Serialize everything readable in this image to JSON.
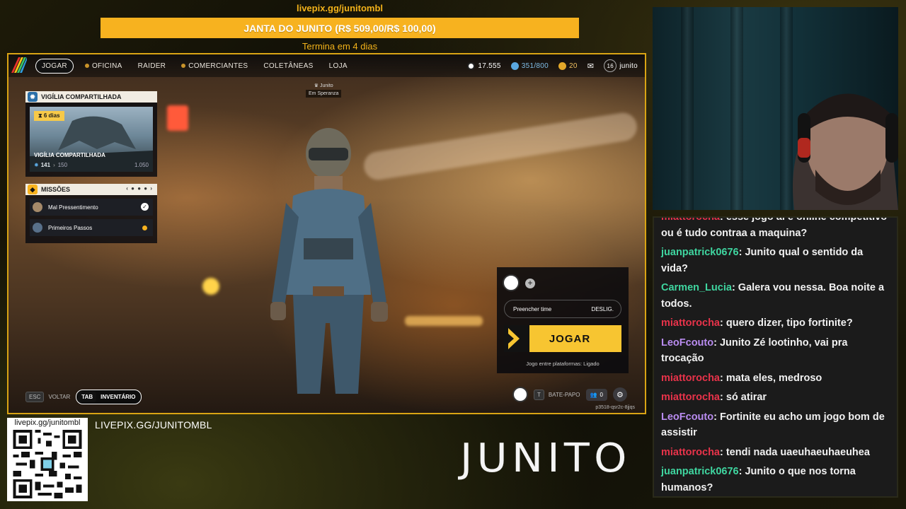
{
  "banner": {
    "livepix_url": "livepix.gg/junitombl",
    "goal_text": "JANTA DO JUNITO (R$ 509,00/R$ 100,00)",
    "goal_timer": "Termina em 4 dias",
    "goal_color": "#f7b21f"
  },
  "game": {
    "nav": {
      "items": [
        {
          "label": "JOGAR",
          "active": true
        },
        {
          "label": "OFICINA"
        },
        {
          "label": "RAIDER"
        },
        {
          "label": "COMERCIANTES"
        },
        {
          "label": "COLETÂNEAS"
        },
        {
          "label": "LOJA"
        }
      ],
      "credits": "17.555",
      "tokens": "351/800",
      "coins": "20",
      "level": "16",
      "username": "junito"
    },
    "location": {
      "name": "Junito",
      "place": "Em Speranza"
    },
    "vigil": {
      "header": "VIGÍLIA COMPARTILHADA",
      "days": "6 dias",
      "title": "VIGÍLIA COMPARTILHADA",
      "current": "141",
      "next": "150",
      "max": "1.050"
    },
    "missions": {
      "header": "MISSÕES",
      "items": [
        {
          "label": "Mal Pressentimento",
          "status": "complete"
        },
        {
          "label": "Primeiros Passos",
          "status": "active"
        }
      ]
    },
    "play": {
      "fill_team_label": "Preencher time",
      "fill_team_value": "DESLIG.",
      "play_label": "JOGAR",
      "crossplay": "Jogo entre plataformas: Ligado"
    },
    "bottom": {
      "esc_key": "ESC",
      "back_label": "VOLTAR",
      "tab_key": "TAB",
      "inventory_label": "INVENTÁRIO",
      "chat_key": "T",
      "chat_label": "BATE-PAPO",
      "friends_count": "0",
      "lobby_code": "p3518-qsr2c-8jjqs"
    }
  },
  "overlay": {
    "qr_url": "livepix.gg/junitombl",
    "livepix_caption": "LIVEPIX.GG/JUNITOMBL",
    "brand": "JUNITO"
  },
  "chat": {
    "messages": [
      {
        "user": "miattorocha",
        "color": "#e8334a",
        "text": ": esse jogo ai é online competitivo ou é tudo contraa a maquina?"
      },
      {
        "user": "juanpatrick0676",
        "color": "#3fd6a0",
        "text": ": Junito qual o sentido da vida?"
      },
      {
        "user": "Carmen_Lucia",
        "color": "#3fd6a0",
        "text": ": Galera vou nessa. Boa noite a todos."
      },
      {
        "user": "miattorocha",
        "color": "#e8334a",
        "text": ": quero dizer, tipo fortinite?"
      },
      {
        "user": "LeoFcouto",
        "color": "#b98cf0",
        "text": ": Junito Zé lootinho, vai pra trocação"
      },
      {
        "user": "miattorocha",
        "color": "#e8334a",
        "text": ": mata eles, medroso"
      },
      {
        "user": "miattorocha",
        "color": "#e8334a",
        "text": ": só atirar"
      },
      {
        "user": "LeoFcouto",
        "color": "#b98cf0",
        "text": ": Fortinite eu acho um jogo bom de assistir"
      },
      {
        "user": "miattorocha",
        "color": "#e8334a",
        "text": ": tendi nada uaeuhaeuhaeuhea"
      },
      {
        "user": "juanpatrick0676",
        "color": "#3fd6a0",
        "text": ": Junito o que nos torna humanos?"
      }
    ]
  }
}
